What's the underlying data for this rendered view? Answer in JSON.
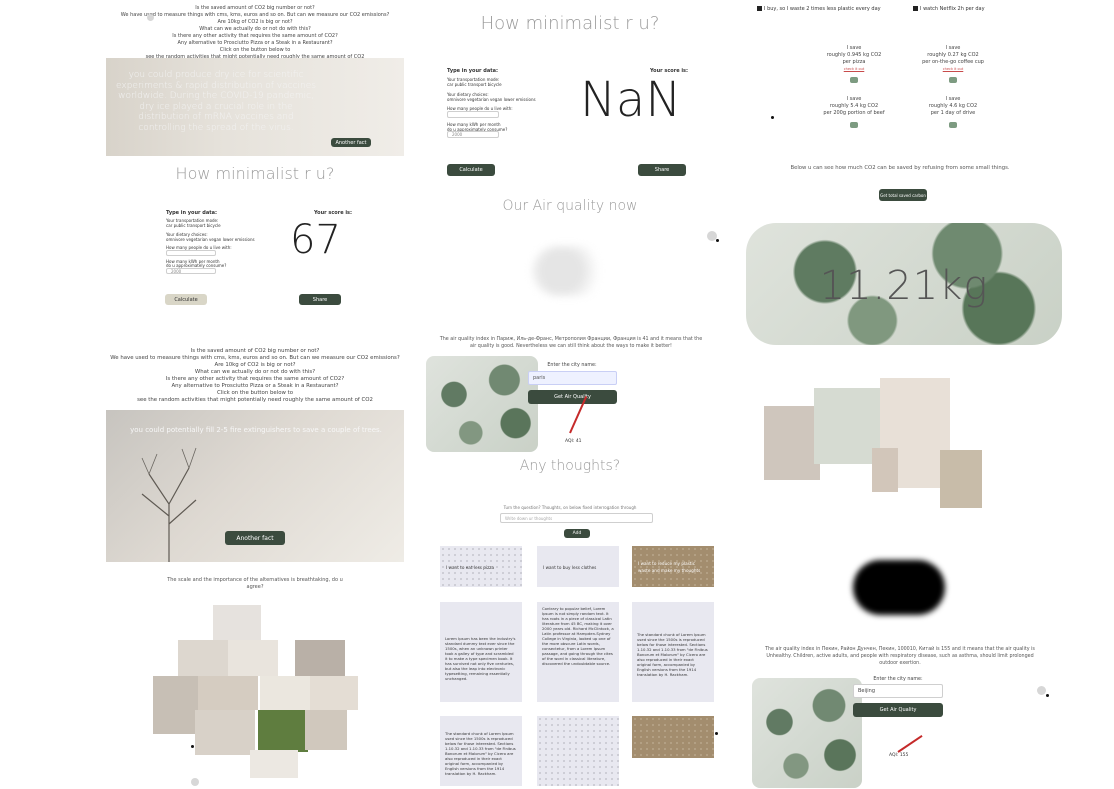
{
  "col1": {
    "top_q": [
      "Is the saved amount of CO2 big number or not?",
      "We have used to measure things with cms, kms, euros and so on. But can we measure our CO2 emissions?",
      "Are 10kg of CO2 is big or not?",
      "What can we actually do or not do with this?",
      "Is there any other activity that requires the same amount of CO2?",
      "Any alternative to Prosciutto Pizza or a Steak in a Restaurant?",
      "Click on the button below to",
      "see the random activities that might potentially need roughly the same amount of CO2"
    ],
    "fact1": "you could produce dry ice for scientific experiments & rapid distribution of vaccines worldwide. During the COVID-19 pandemic, dry ice played a crucial role in the distribution of mRNA vaccines and controlling the spread of the virus.",
    "fact1_btn": "Another fact",
    "mini_title": "How minimalist r u?",
    "mini_type": "Type in your data:",
    "mini_score_label": "Your score is:",
    "mini_transport": "Your transportation mode:",
    "mini_transport_opts": "car  public transport  bicycle",
    "mini_diet": "Your dietary choices:",
    "mini_diet_opts": "omnivore  vegetarian  vegan  lower emissions",
    "mini_people": "How many people do u live with:",
    "mini_kwh": "How many kWh per month",
    "mini_kwh2": "do u approximately consume?",
    "mini_kwh_val": "2000",
    "mini_score": "67",
    "mini_calc": "Calculate",
    "mini_share": "Share",
    "mid_q": [
      "Is the saved amount of CO2 big number or not?",
      "We have used to measure things with cms, kms, euros and so on. But can we measure our CO2 emissions?",
      "Are 10kg of CO2 is big or not?",
      "What can we actually do or not do with this?",
      "Is there any other activity that requires the same amount of CO2?",
      "Any alternative to Prosciutto Pizza or a Steak in a Restaurant?",
      "Click on the button below to",
      "see the random activities that might potentially need roughly the same amount of CO2"
    ],
    "fact2": "you could potentially fill 2-5 fire extinguishers to save a couple of trees.",
    "fact2_btn": "Another fact",
    "bottom_text": "The scale and the importance of the alternatives is breathtaking, do u agree?"
  },
  "col2": {
    "title": "How minimalist r u?",
    "type_label": "Type in your data:",
    "score_label": "Your score is:",
    "transport_label": "Your transportation mode:",
    "transport_opts": "car  public transport  bicycle",
    "diet_label": "Your dietary choices:",
    "diet_opts": "omnivore  vegetarian  vegan  lower emissions",
    "people_label": "How many people do u live with:",
    "kwh_label": "How many kWh per month",
    "kwh_label2": "do u approximately consume?",
    "kwh_val": "2000",
    "score": "NaN",
    "calc": "Calculate",
    "share": "Share",
    "air_title": "Our Air quality now",
    "air_desc": "The air quality index in Париж, Иль-де-Франс, Метрополия Франции, Франция is 41 and it means that the air quality is good. Nevertheless we can still think about the ways to make it better!",
    "city_label": "Enter the city name:",
    "city_val": "paris",
    "air_btn": "Get Air Quality",
    "aqi": "AQI: 41",
    "thoughts_title": "Any thoughts?",
    "thoughts_hint": "Turn the question? Thoughts, on below fixed interrogation through",
    "thoughts_placeholder": "Write down ur thoughts",
    "add_btn": "Add",
    "card1": "I want to eat less pizza",
    "card2": "I want to buy less clothes",
    "card3": "I want to reduce my plastic waste and make my thoughts",
    "lorem1": "Lorem Ipsum has been the industry's standard dummy text ever since the 1500s, when an unknown printer took a galley of type and scrambled it to make a type specimen book. It has survived not only five centuries, but also the leap into electronic typesetting, remaining essentially unchanged.",
    "lorem2": "Contrary to popular belief, Lorem Ipsum is not simply random text. It has roots in a piece of classical Latin literature from 45 BC, making it over 2000 years old. Richard McClintock, a Latin professor at Hampden-Sydney College in Virginia, looked up one of the more obscure Latin words, consectetur, from a Lorem Ipsum passage, and going through the cites of the word in classical literature, discovered the undoubtable source.",
    "lorem3": "The standard chunk of Lorem Ipsum used since the 1500s is reproduced below for those interested. Sections 1.10.32 and 1.10.33 from \"de Finibus Bonorum et Malorum\" by Cicero are also reproduced in their exact original form, accompanied by English versions from the 1914 translation by H. Rackham.",
    "lorem4": "The standard chunk of Lorem Ipsum used since the 1500s is reproduced below for those interested. Sections 1.10.32 and 1.10.33 from \"de Finibus Bonorum et Malorum\" by Cicero are also reproduced in their exact original form, accompanied by English versions from the 1914 translation by H. Rackham."
  },
  "col3": {
    "check1": "I buy, so I waste 2 times less plastic every day",
    "check2": "I watch Netflix 2h per day",
    "save_items": [
      {
        "a": "I save",
        "b": "roughly 0.945 kg CO2",
        "c": "per pizza",
        "d": "check it out"
      },
      {
        "a": "I save",
        "b": "roughly 0.27 kg CO2",
        "c": "per on-the-go coffee cup",
        "d": "check it out"
      },
      {
        "a": "I save",
        "b": "roughly 5.4 kg CO2",
        "c": "per 200g portion of beef",
        "d": ""
      },
      {
        "a": "I save",
        "b": "roughly 4.6 kg CO2",
        "c": "per 1 day of drive",
        "d": ""
      }
    ],
    "below": "Below u can see how much CO2 can be saved by refusing from some small things.",
    "total_btn": "Get total saved carbon",
    "total": "11.21kg",
    "air_desc": "The air quality index in Пекин, Район Дунчен, Пекин, 100010, Китай is 155 and it means that the air quality is Unhealthy. Children, active adults, and people with respiratory disease, such as asthma, should limit prolonged outdoor exertion.",
    "city_label": "Enter the city name:",
    "city_val": "Beijing",
    "air_btn": "Get Air Quality",
    "aqi": "AQI: 155"
  }
}
